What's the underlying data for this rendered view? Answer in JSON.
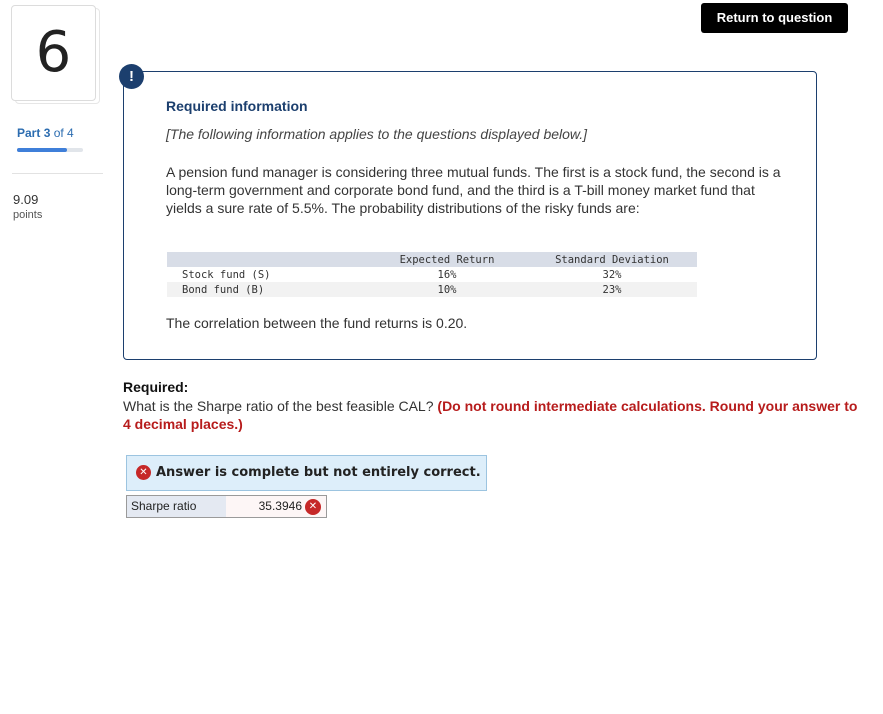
{
  "header": {
    "return_button": "Return to question"
  },
  "sidebar": {
    "question_number": "6",
    "part_label": "Part",
    "part_current": "3",
    "part_of": "of 4",
    "progress_fraction": 0.75,
    "points_value": "9.09",
    "points_label": "points"
  },
  "info": {
    "alert_glyph": "!",
    "title": "Required information",
    "note": "[The following information applies to the questions displayed below.]",
    "body": "A pension fund manager is considering three mutual funds. The first is a stock fund, the second is a long-term government and corporate bond fund, and the third is a T-bill money market fund that yields a sure rate of 5.5%. The probability distributions of the risky funds are:",
    "table": {
      "headers": [
        "",
        "Expected Return",
        "Standard Deviation"
      ],
      "rows": [
        [
          "Stock fund (S)",
          "16%",
          "32%"
        ],
        [
          "Bond fund (B)",
          "10%",
          "23%"
        ]
      ]
    },
    "correlation": "The correlation between the fund returns is 0.20."
  },
  "required": {
    "heading": "Required:",
    "question": "What is the Sharpe ratio of the best feasible CAL?",
    "instruction": "(Do not round intermediate calculations. Round your answer to 4 decimal places.)"
  },
  "answer": {
    "status": "Answer is complete but not entirely correct.",
    "label": "Sharpe ratio",
    "value": "35.3946",
    "status_icon": "x-circle-icon",
    "colors": {
      "incorrect": "#c62828",
      "status_bg": "#ddeefa",
      "accent": "#1c3f6e"
    }
  }
}
